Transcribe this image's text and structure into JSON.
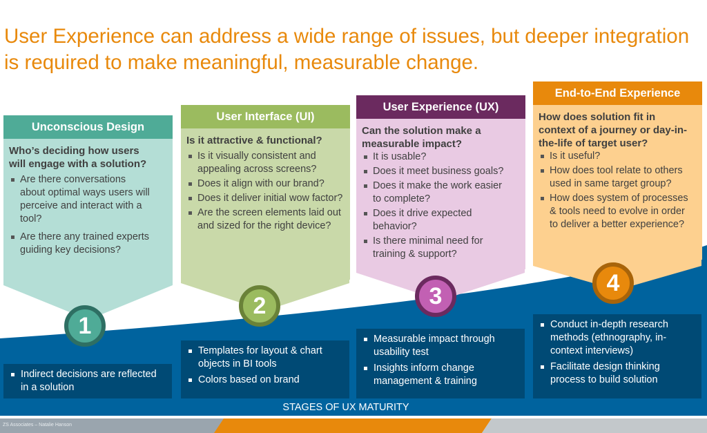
{
  "title": "User Experience can address a wide range of issues, but deeper integration is required to make meaningful, measurable change.",
  "stages": [
    {
      "number": "1",
      "header": "Unconscious Design",
      "question": "Who’s deciding how users will engage with a solution?",
      "bullets": [
        "Are there conversations about optimal ways users will perceive and interact with a tool?",
        "Are there any trained experts guiding key decisions?"
      ],
      "outcomes": [
        "Indirect decisions are reflected in a solution"
      ],
      "colors": {
        "header": "#4fab97",
        "body": "#b4ded6",
        "circle_fill": "#4fab97",
        "circle_ring": "#2e6f63"
      }
    },
    {
      "number": "2",
      "header": "User Interface (UI)",
      "question": "Is it attractive & functional?",
      "bullets": [
        "Is it visually consistent and appealing across screens?",
        "Does it align with our brand?",
        "Does it deliver initial wow factor?",
        "Are the screen elements laid out and sized for the right device?"
      ],
      "outcomes": [
        "Templates for layout & chart objects  in BI tools",
        "Colors based on brand"
      ],
      "colors": {
        "header": "#9bbb5f",
        "body": "#c9d9a9",
        "circle_fill": "#9bbb5f",
        "circle_ring": "#6a8238"
      }
    },
    {
      "number": "3",
      "header": "User Experience (UX)",
      "question": "Can the solution make a measurable impact?",
      "bullets": [
        "It is usable?",
        "Does it meet business goals?",
        "Does it make the work easier to complete?",
        "Does it drive expected behavior?",
        "Is there minimal need for training & support?"
      ],
      "outcomes": [
        "Measurable impact through usability test",
        "Insights inform change management & training"
      ],
      "colors": {
        "header": "#6b2a5f",
        "body": "#e9cae3",
        "circle_fill": "#c260b3",
        "circle_ring": "#6b2a5f"
      }
    },
    {
      "number": "4",
      "header": "End-to-End Experience",
      "question": "How does solution fit in context of a journey or day-in-the-life of target user?",
      "bullets": [
        "Is it useful?",
        "How does tool relate to others used in same target group?",
        "How does system of processes & tools need to evolve in order to deliver a better experience?"
      ],
      "outcomes": [
        "Conduct in-depth research methods (ethnography, in-context interviews)",
        "Facilitate design thinking process to build solution"
      ],
      "colors": {
        "header": "#e8890c",
        "body": "#fdd08f",
        "circle_fill": "#e8890c",
        "circle_ring": "#a8640a"
      }
    }
  ],
  "stages_label": "STAGES OF UX MATURITY",
  "footer": {
    "credit": "ZS Associates – Natalie Hanson"
  },
  "colors": {
    "title": "#e8890c",
    "wave": "#00639e",
    "outcome_box": "#004a75",
    "footer_gray": "#9aa5ae",
    "footer_orange": "#e8890c",
    "footer_light": "#c3c8cb"
  }
}
